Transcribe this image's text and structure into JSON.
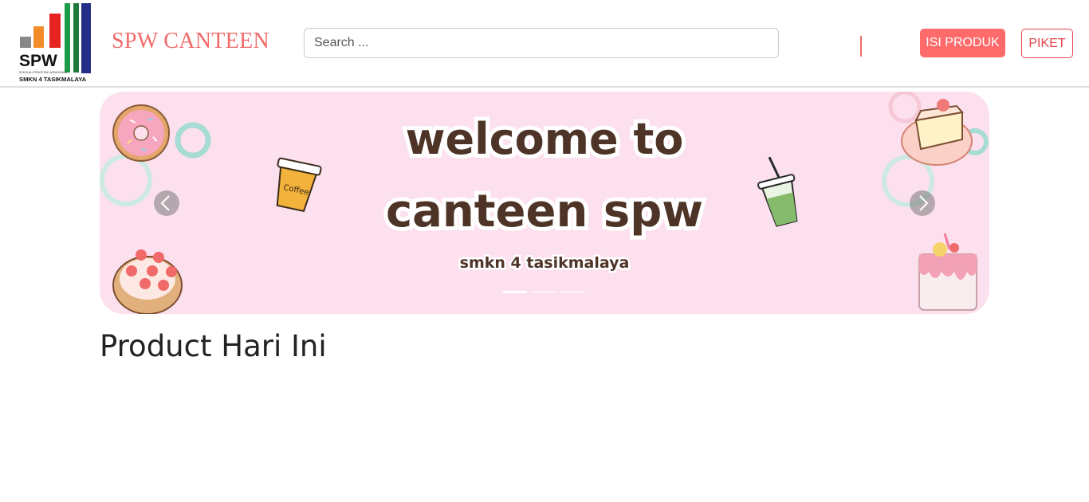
{
  "header": {
    "logo": {
      "text": "SPW",
      "tagline": "SEKOLAH PENCETAK WIRAUSAHA",
      "subtitle": "SMKN 4 TASIKMALAYA"
    },
    "brand": "SPW CANTEEN",
    "search": {
      "placeholder": "Search ...",
      "value": ""
    },
    "buttons": {
      "isi_produk": "ISI PRODUK",
      "piket": "PIKET"
    }
  },
  "carousel": {
    "headline_1": "welcome to",
    "headline_2": "canteen spw",
    "subline": "smkn 4 tasikmalaya",
    "coffee_cup_label": "Coffee",
    "prev_icon": "chevron-left-icon",
    "next_icon": "chevron-right-icon",
    "slide_count": 3,
    "active_slide": 1
  },
  "main": {
    "section_title": "Product Hari Ini"
  },
  "colors": {
    "brand": "#f16a6a",
    "primary_button": "#ff6b6b",
    "outline_button": "#e0464c",
    "banner_bg": "#fde0ee",
    "banner_text": "#4e3427"
  }
}
